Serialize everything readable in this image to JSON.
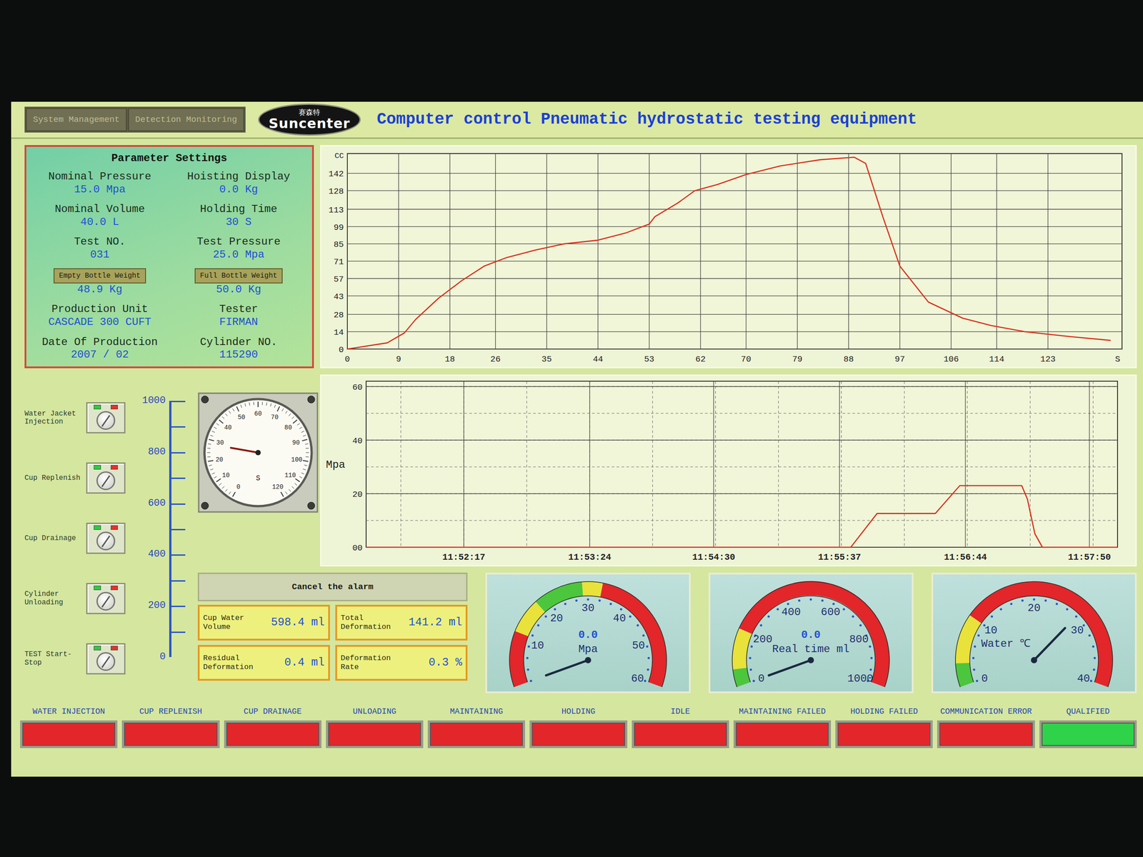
{
  "window": {
    "title": "Computer control Pneumatic hydrostatic testing equipment"
  },
  "nav": [
    {
      "label": "System Management",
      "selected": false
    },
    {
      "label": "Detection Monitoring",
      "selected": false
    }
  ],
  "logo": {
    "top": "赛森特",
    "bottom": "Suncenter"
  },
  "parameters": {
    "title": "Parameter Settings",
    "items": [
      {
        "label": "Nominal Pressure",
        "value": "15.0 Mpa",
        "kind": "label"
      },
      {
        "label": "Hoisting Display",
        "value": "0.0 Kg",
        "kind": "label"
      },
      {
        "label": "Nominal Volume",
        "value": "40.0 L",
        "kind": "label"
      },
      {
        "label": "Holding Time",
        "value": "30 S",
        "kind": "label"
      },
      {
        "label": "Test NO.",
        "value": "031",
        "kind": "label"
      },
      {
        "label": "Test Pressure",
        "value": "25.0 Mpa",
        "kind": "label"
      },
      {
        "label": "Empty Bottle Weight",
        "value": "48.9 Kg",
        "kind": "button"
      },
      {
        "label": "Full Bottle Weight",
        "value": "50.0 Kg",
        "kind": "button"
      },
      {
        "label": "Production Unit",
        "value": "CASCADE 300 CUFT",
        "kind": "label"
      },
      {
        "label": "Tester",
        "value": "FIRMAN",
        "kind": "label"
      },
      {
        "label": "Date Of Production",
        "value": "2007 / 02",
        "kind": "label"
      },
      {
        "label": "Cylinder NO.",
        "value": "115290",
        "kind": "label"
      }
    ]
  },
  "volume_chart": {
    "y_unit": "CC",
    "x_unit": "S",
    "x_max": 136,
    "y_max": 158,
    "y_ticks": [
      {
        "label": "0",
        "value": 0
      },
      {
        "label": "14",
        "value": 14
      },
      {
        "label": "28",
        "value": 28
      },
      {
        "label": "43",
        "value": 43
      },
      {
        "label": "57",
        "value": 57
      },
      {
        "label": "71",
        "value": 71
      },
      {
        "label": "85",
        "value": 85
      },
      {
        "label": "99",
        "value": 99
      },
      {
        "label": "113",
        "value": 113
      },
      {
        "label": "128",
        "value": 128
      },
      {
        "label": "142",
        "value": 142
      }
    ],
    "x_ticks": [
      {
        "label": "0",
        "value": 0
      },
      {
        "label": "9",
        "value": 9
      },
      {
        "label": "18",
        "value": 18
      },
      {
        "label": "26",
        "value": 26
      },
      {
        "label": "35",
        "value": 35
      },
      {
        "label": "44",
        "value": 44
      },
      {
        "label": "53",
        "value": 53
      },
      {
        "label": "62",
        "value": 62
      },
      {
        "label": "70",
        "value": 70
      },
      {
        "label": "79",
        "value": 79
      },
      {
        "label": "88",
        "value": 88
      },
      {
        "label": "97",
        "value": 97
      },
      {
        "label": "106",
        "value": 106
      },
      {
        "label": "114",
        "value": 114
      },
      {
        "label": "123",
        "value": 123
      }
    ],
    "series": [
      {
        "color": "#d8321e",
        "x": [
          0,
          7,
          10,
          12,
          16,
          20,
          24,
          28,
          33,
          38,
          44,
          49,
          53,
          54,
          58,
          61,
          65,
          70,
          76,
          83,
          89,
          91,
          94,
          97,
          102,
          108,
          113,
          119,
          127,
          134
        ],
        "y": [
          0,
          5,
          13,
          24,
          41,
          55,
          67,
          74,
          80,
          85,
          88,
          94,
          101,
          107,
          118,
          128,
          133,
          141,
          148,
          153,
          155,
          150,
          107,
          67,
          38,
          25,
          19,
          14,
          10,
          7
        ]
      }
    ]
  },
  "pressure_chart": {
    "y_unit": "Mpa",
    "x_max": 400,
    "y_max": 62,
    "y_ticks": [
      {
        "label": "00",
        "value": 0
      },
      {
        "label": "20",
        "value": 20
      },
      {
        "label": "40",
        "value": 40
      },
      {
        "label": "60",
        "value": 60
      }
    ],
    "x_ticks": [
      {
        "label": "11:52:17",
        "value": 52
      },
      {
        "label": "11:53:24",
        "value": 119
      },
      {
        "label": "11:54:30",
        "value": 185
      },
      {
        "label": "11:55:37",
        "value": 252
      },
      {
        "label": "11:56:44",
        "value": 319
      },
      {
        "label": "11:57:50",
        "value": 385
      }
    ],
    "series": [
      {
        "color": "#d8321e",
        "x": [
          0,
          258,
          272,
          303,
          316,
          349,
          352,
          356,
          360,
          400
        ],
        "y": [
          0,
          0,
          12.6,
          12.6,
          23,
          23,
          18,
          5,
          0,
          0
        ]
      }
    ]
  },
  "switches": [
    {
      "label": "Water Jacket Injection"
    },
    {
      "label": "Cup Replenish"
    },
    {
      "label": "Cup Drainage"
    },
    {
      "label": "Cylinder Unloading"
    },
    {
      "label": "TEST Start-Stop"
    }
  ],
  "tank": {
    "ticks": [
      "1000",
      "800",
      "600",
      "400",
      "200",
      "0"
    ],
    "level": 0
  },
  "timer": {
    "unit": "S",
    "ticks": [
      "0",
      "10",
      "20",
      "30",
      "40",
      "50",
      "60",
      "70",
      "80",
      "90",
      "100",
      "110",
      "120"
    ],
    "level": 0.233
  },
  "alarm_button": "Cancel the alarm",
  "readouts": [
    {
      "label": "Cup Water Volume",
      "value": "598.4 ml"
    },
    {
      "label": "Total Deformation",
      "value": "141.2 ml"
    },
    {
      "label": "Residual Deformation",
      "value": "0.4 ml"
    },
    {
      "label": "Deformation Rate",
      "value": "0.3 %"
    }
  ],
  "gauges": [
    {
      "unit": "Mpa",
      "value": "0.0",
      "max": 60,
      "ticks": [
        "10",
        "20",
        "30",
        "40",
        "50",
        "60"
      ],
      "level": 0,
      "bands": [
        {
          "to": 0.19,
          "color": "#e2262a"
        },
        {
          "to": 0.31,
          "color": "#e8e23a"
        },
        {
          "to": 0.48,
          "color": "#4cc63c"
        },
        {
          "to": 0.55,
          "color": "#e8e23a"
        },
        {
          "to": 1,
          "color": "#e2262a"
        }
      ]
    },
    {
      "unit": "Real time ml",
      "value": "0.0",
      "max": 1000,
      "ticks": [
        "0",
        "200",
        "400",
        "600",
        "800",
        "1000"
      ],
      "level": 0,
      "bands": [
        {
          "to": 0.06,
          "color": "#4cc63c"
        },
        {
          "to": 0.2,
          "color": "#e8e23a"
        },
        {
          "to": 1,
          "color": "#e2262a"
        }
      ]
    },
    {
      "unit": "Water ℃",
      "max": 40,
      "ticks": [
        "0",
        "10",
        "20",
        "30",
        "40"
      ],
      "level": 0.7,
      "bands": [
        {
          "to": 0.08,
          "color": "#4cc63c"
        },
        {
          "to": 0.25,
          "color": "#e8e23a"
        },
        {
          "to": 1,
          "color": "#e2262a"
        }
      ]
    }
  ],
  "status": [
    {
      "label": "WATER INJECTION",
      "color": "#e3262a"
    },
    {
      "label": "CUP REPLENISH",
      "color": "#e3262a"
    },
    {
      "label": "CUP DRAINAGE",
      "color": "#e3262a"
    },
    {
      "label": "UNLOADING",
      "color": "#e3262a"
    },
    {
      "label": "MAINTAINING",
      "color": "#e3262a"
    },
    {
      "label": "HOLDING",
      "color": "#e3262a"
    },
    {
      "label": "IDLE",
      "color": "#e3262a"
    },
    {
      "label": "MAINTAINING FAILED",
      "color": "#e3262a"
    },
    {
      "label": "HOLDING FAILED",
      "color": "#e3262a"
    },
    {
      "label": "COMMUNICATION ERROR",
      "color": "#e3262a"
    },
    {
      "label": "QUALIFIED",
      "color": "#2fd34a"
    }
  ]
}
